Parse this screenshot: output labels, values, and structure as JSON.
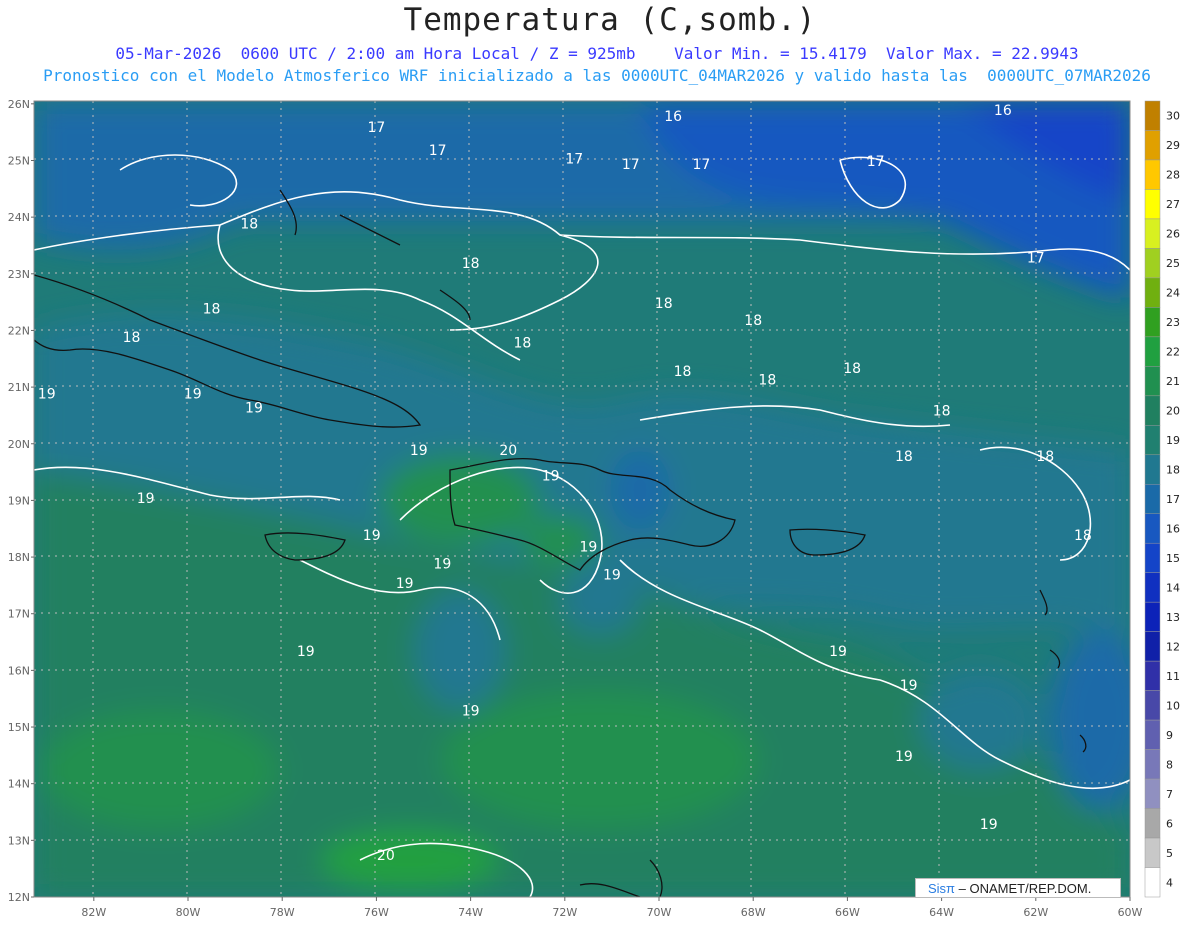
{
  "header": {
    "title": "Temperatura (C,somb.)",
    "line1": "05-Mar-2026  0600 UTC / 2:00 am Hora Local / Z = 925mb    Valor Min. = 15.4179  Valor Max. = 22.9943",
    "line2": "Pronostico con el Modelo Atmosferico WRF inicializado a las 0000UTC_04MAR2026 y valido hasta las  0000UTC_07MAR2026"
  },
  "axes": {
    "lat_labels": [
      "26N",
      "25N",
      "24N",
      "23N",
      "22N",
      "21N",
      "20N",
      "19N",
      "18N",
      "17N",
      "16N",
      "15N",
      "14N",
      "13N",
      "12N"
    ],
    "lon_labels": [
      "82W",
      "80W",
      "78W",
      "76W",
      "74W",
      "72W",
      "70W",
      "68W",
      "66W",
      "64W",
      "62W",
      "60W"
    ]
  },
  "colorbar": {
    "levels": [
      "30",
      "29",
      "28",
      "27",
      "26",
      "25",
      "24",
      "23",
      "22",
      "21",
      "20",
      "19",
      "18",
      "17",
      "16",
      "15",
      "14",
      "13",
      "12",
      "11",
      "10",
      "9",
      "8",
      "7",
      "6",
      "5",
      "4"
    ],
    "colors": [
      "#c08000",
      "#e0a000",
      "#ffc800",
      "#ffff00",
      "#d8f020",
      "#a0d020",
      "#70b010",
      "#30a020",
      "#20a040",
      "#209050",
      "#208060",
      "#208070",
      "#207890",
      "#1a6aa8",
      "#1858c0",
      "#1444c8",
      "#1030c0",
      "#0c22b8",
      "#1020a8",
      "#3030a8",
      "#4848a8",
      "#6060b0",
      "#7878b8",
      "#9090c0",
      "#a8a8a8",
      "#c8c8c8",
      "#ffffff"
    ]
  },
  "contour_labels": [
    {
      "text": "16",
      "lon": -69.7,
      "lat": 25.7
    },
    {
      "text": "16",
      "lon": -62.7,
      "lat": 25.8
    },
    {
      "text": "17",
      "lon": -76.0,
      "lat": 25.5
    },
    {
      "text": "17",
      "lon": -74.7,
      "lat": 25.1
    },
    {
      "text": "17",
      "lon": -71.8,
      "lat": 24.95
    },
    {
      "text": "17",
      "lon": -70.6,
      "lat": 24.85
    },
    {
      "text": "17",
      "lon": -69.1,
      "lat": 24.85
    },
    {
      "text": "17",
      "lon": -65.4,
      "lat": 24.9
    },
    {
      "text": "17",
      "lon": -62.0,
      "lat": 23.2
    },
    {
      "text": "18",
      "lon": -78.7,
      "lat": 23.8
    },
    {
      "text": "18",
      "lon": -74.0,
      "lat": 23.1
    },
    {
      "text": "18",
      "lon": -79.5,
      "lat": 22.3
    },
    {
      "text": "18",
      "lon": -81.2,
      "lat": 21.8
    },
    {
      "text": "18",
      "lon": -72.9,
      "lat": 21.7
    },
    {
      "text": "18",
      "lon": -69.9,
      "lat": 22.4
    },
    {
      "text": "18",
      "lon": -68.0,
      "lat": 22.1
    },
    {
      "text": "18",
      "lon": -69.5,
      "lat": 21.2
    },
    {
      "text": "18",
      "lon": -67.7,
      "lat": 21.05
    },
    {
      "text": "18",
      "lon": -65.9,
      "lat": 21.25
    },
    {
      "text": "18",
      "lon": -64.0,
      "lat": 20.5
    },
    {
      "text": "18",
      "lon": -64.8,
      "lat": 19.7
    },
    {
      "text": "18",
      "lon": -61.8,
      "lat": 19.7
    },
    {
      "text": "18",
      "lon": -61.0,
      "lat": 18.3
    },
    {
      "text": "19",
      "lon": -83.0,
      "lat": 20.8
    },
    {
      "text": "19",
      "lon": -79.9,
      "lat": 20.8
    },
    {
      "text": "19",
      "lon": -78.6,
      "lat": 20.55
    },
    {
      "text": "19",
      "lon": -75.1,
      "lat": 19.8
    },
    {
      "text": "20",
      "lon": -73.2,
      "lat": 19.8
    },
    {
      "text": "19",
      "lon": -72.3,
      "lat": 19.35
    },
    {
      "text": "19",
      "lon": -80.9,
      "lat": 18.95
    },
    {
      "text": "19",
      "lon": -76.1,
      "lat": 18.3
    },
    {
      "text": "19",
      "lon": -74.6,
      "lat": 17.8
    },
    {
      "text": "19",
      "lon": -71.5,
      "lat": 18.1
    },
    {
      "text": "19",
      "lon": -75.4,
      "lat": 17.45
    },
    {
      "text": "19",
      "lon": -71.0,
      "lat": 17.6
    },
    {
      "text": "19",
      "lon": -77.5,
      "lat": 16.25
    },
    {
      "text": "19",
      "lon": -74.0,
      "lat": 15.2
    },
    {
      "text": "19",
      "lon": -66.2,
      "lat": 16.25
    },
    {
      "text": "19",
      "lon": -64.7,
      "lat": 15.65
    },
    {
      "text": "19",
      "lon": -64.8,
      "lat": 14.4
    },
    {
      "text": "19",
      "lon": -63.0,
      "lat": 13.2
    },
    {
      "text": "20",
      "lon": -75.8,
      "lat": 12.65
    }
  ],
  "credit": {
    "brand": "Sisπ",
    "rest": "– ONAMET/REP.DOM."
  }
}
